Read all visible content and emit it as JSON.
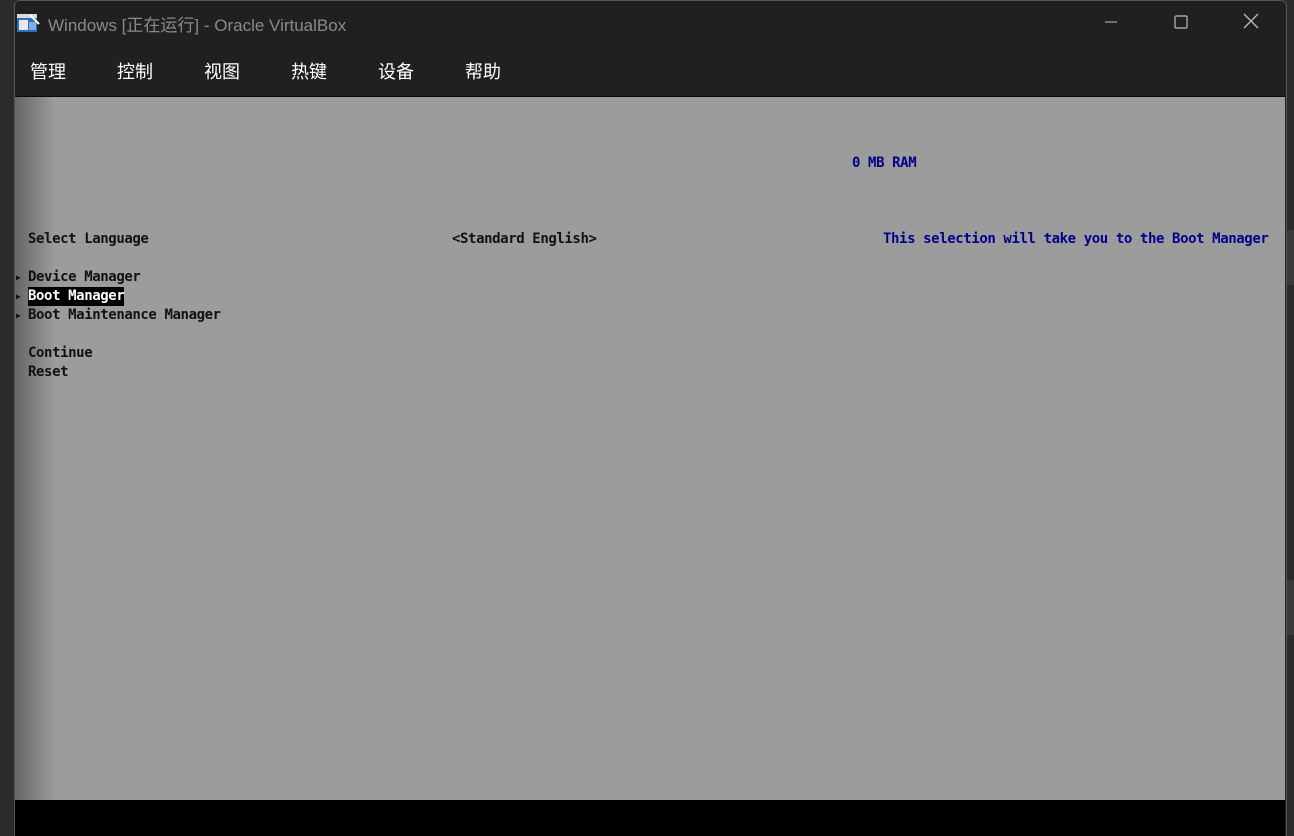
{
  "window": {
    "title": "Windows [正在运行] - Oracle VirtualBox",
    "controls": {
      "minimize_icon": "minimize-icon",
      "maximize_icon": "maximize-icon",
      "close_icon": "close-icon"
    }
  },
  "menubar": {
    "items": [
      {
        "label": "管理"
      },
      {
        "label": "控制"
      },
      {
        "label": "视图"
      },
      {
        "label": "热键"
      },
      {
        "label": "设备"
      },
      {
        "label": "帮助"
      }
    ]
  },
  "uefi": {
    "ram": "0 MB RAM",
    "select_language_label": "Select Language",
    "language_value": "<Standard English>",
    "help_text": "This selection will take you to the Boot Manager",
    "menu": [
      {
        "label": "Device Manager",
        "has_submenu": true,
        "selected": false
      },
      {
        "label": "Boot Manager",
        "has_submenu": true,
        "selected": true
      },
      {
        "label": "Boot Maintenance Manager",
        "has_submenu": true,
        "selected": false
      }
    ],
    "actions": [
      {
        "label": "Continue"
      },
      {
        "label": "Reset"
      }
    ]
  },
  "colors": {
    "titlebar_bg": "#202020",
    "vm_screen_bg": "#9c9c9c",
    "uefi_text": "#111111",
    "uefi_highlight_text": "#00008b",
    "selection_bg": "#000000",
    "selection_text": "#ffffff"
  }
}
